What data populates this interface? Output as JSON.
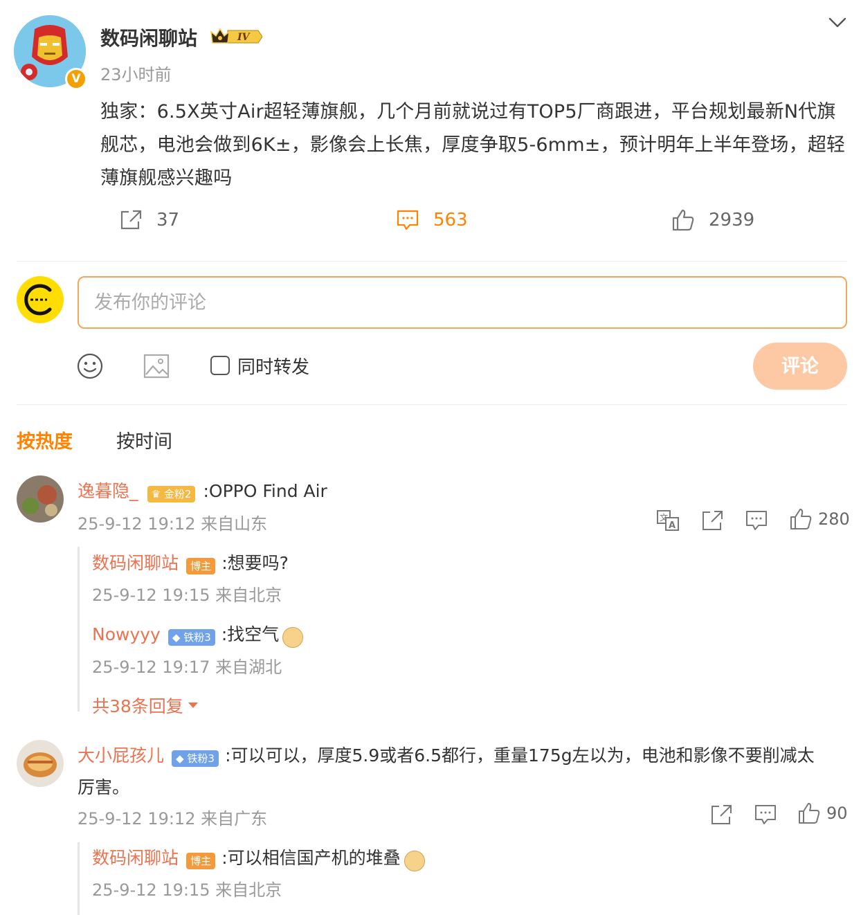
{
  "post": {
    "author": "数码闲聊站",
    "level_badge": "IV",
    "verify_badge": "V",
    "time": "23小时前",
    "text": "独家：6.5X英寸Air超轻薄旗舰，几个月前就说过有TOP5厂商跟进，平台规划最新N代旗舰芯，电池会做到6K±，影像会上长焦，厚度争取5-6mm±，预计明年上半年登场，超轻薄旗舰感兴趣吗",
    "reposts": "37",
    "comments": "563",
    "likes": "2939"
  },
  "composer": {
    "placeholder": "发布你的评论",
    "repost_label": "同时转发",
    "submit_label": "评论"
  },
  "sort_tabs": {
    "hot": "按热度",
    "time": "按时间"
  },
  "comments": [
    {
      "user": "逸暮隐_",
      "badge": "金粉2",
      "text": ":OPPO Find Air",
      "meta": "25-9-12 19:12 来自山东",
      "likes": "280",
      "replies": [
        {
          "user": "数码闲聊站",
          "badge": "博主",
          "text": ":想要吗?",
          "meta": "25-9-12 19:15 来自北京"
        },
        {
          "user": "Nowyyy",
          "badge": "铁粉3",
          "text": ":找空气",
          "meta": "25-9-12 19:17 来自湖北"
        }
      ],
      "more_replies": "共38条回复"
    },
    {
      "user": "大小屁孩儿",
      "badge": "铁粉3",
      "text": ":可以可以，厚度5.9或者6.5都行，重量175g左以为，电池和影像不要削减太",
      "text_line2": "厉害。",
      "meta": "25-9-12 19:12 来自广东",
      "likes": "90",
      "replies": [
        {
          "user": "数码闲聊站",
          "badge": "博主",
          "text": ":可以相信国产机的堆叠",
          "meta": "25-9-12 19:15 来自北京"
        }
      ]
    }
  ],
  "colors": {
    "accent": "#ff8200",
    "username": "#eb7350",
    "submit_disabled": "#fdc9a4"
  }
}
